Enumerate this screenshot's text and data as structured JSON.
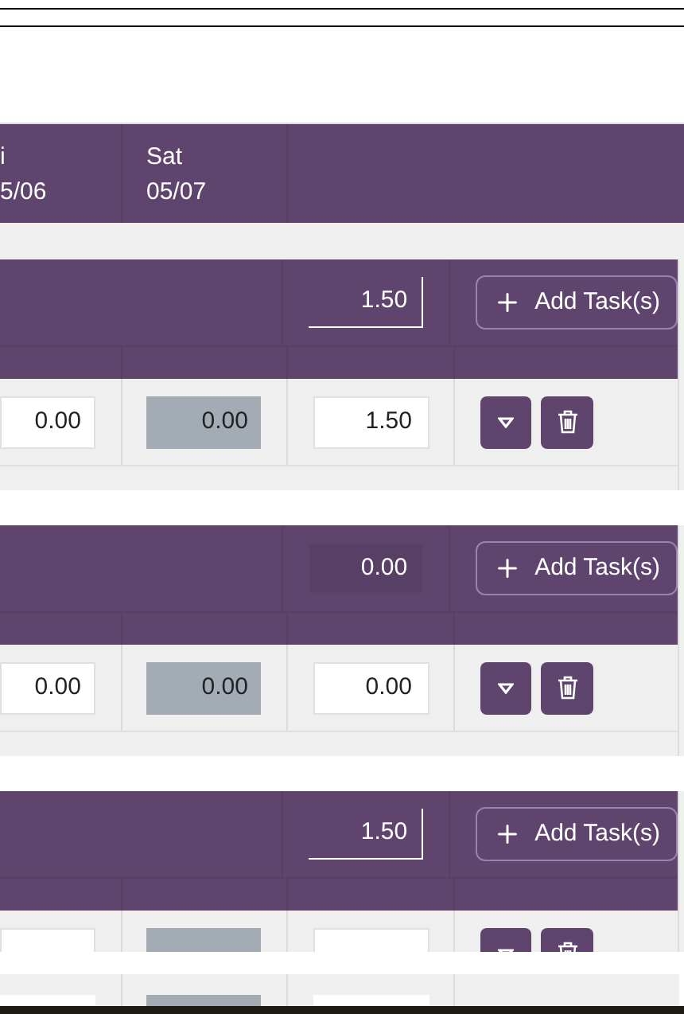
{
  "header": {
    "days": [
      {
        "day": "i",
        "date": "5/06"
      },
      {
        "day": "Sat",
        "date": "05/07"
      }
    ]
  },
  "groups": [
    {
      "total": "1.50",
      "total_highlighted": true,
      "add_button": "Add Task(s)",
      "row": {
        "column_1": "0.00",
        "column_2": "0.00",
        "column_3": "1.50"
      }
    },
    {
      "total": "0.00",
      "total_highlighted": false,
      "add_button": "Add Task(s)",
      "row": {
        "column_1": "0.00",
        "column_2": "0.00",
        "column_3": "0.00"
      }
    },
    {
      "total": "1.50",
      "total_highlighted": true,
      "add_button": "Add Task(s)"
    }
  ]
}
